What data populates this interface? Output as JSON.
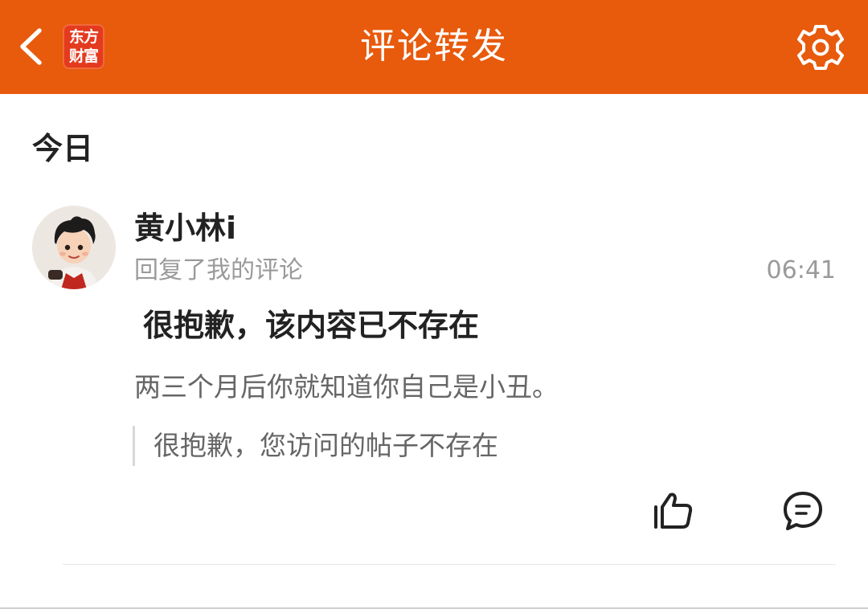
{
  "header": {
    "title": "评论转发",
    "back_icon": "chevron-left-icon",
    "settings_icon": "gear-icon",
    "background_color": "#E85A0C",
    "logo": {
      "line1": "东方",
      "line2": "财富",
      "color": "#E43A1E"
    }
  },
  "section": {
    "title": "今日"
  },
  "notification": {
    "username": "黄小林i",
    "action": "回复了我的评论",
    "time": "06:41",
    "deleted_title": "很抱歉，该内容已不存在",
    "reply_content": "两三个月后你就知道你自己是小丑。",
    "quoted_text": "很抱歉，您访问的帖子不存在",
    "like_icon": "thumbs-up-icon",
    "comment_icon": "comment-icon"
  }
}
